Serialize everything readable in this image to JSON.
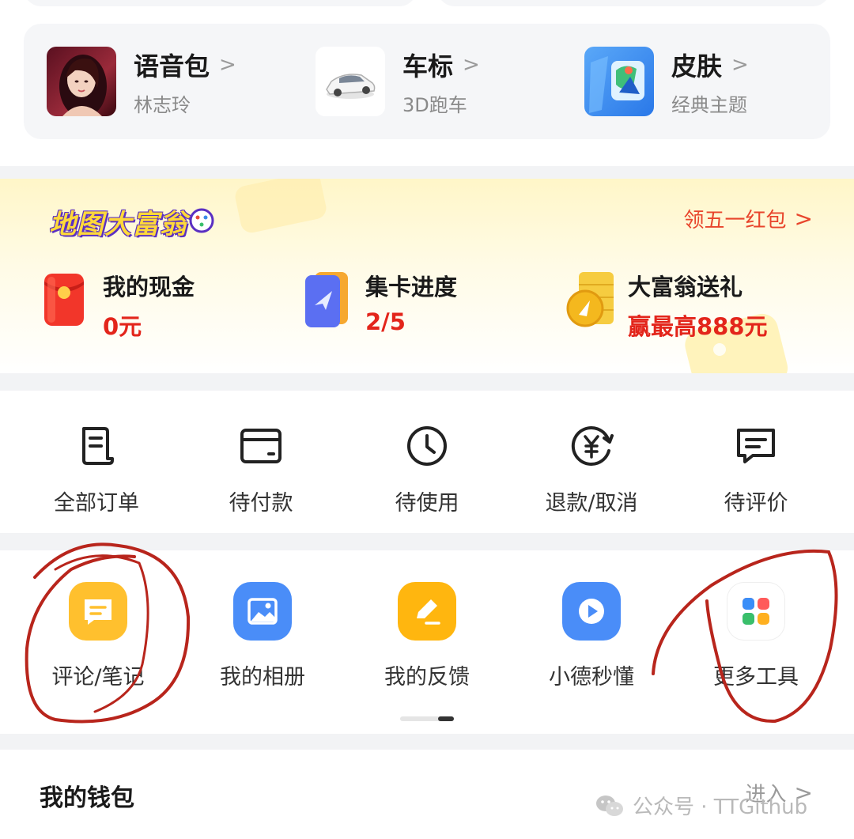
{
  "personalization": [
    {
      "title": "语音包",
      "subtitle": "林志玲",
      "icon": "voice-avatar"
    },
    {
      "title": "车标",
      "subtitle": "3D跑车",
      "icon": "car-icon"
    },
    {
      "title": "皮肤",
      "subtitle": "经典主题",
      "icon": "skin-map-icon"
    }
  ],
  "chevron": ">",
  "monopoly": {
    "logo_text": "地图大富翁",
    "link_label": "领五一红包",
    "items": [
      {
        "label": "我的现金",
        "value": "0元",
        "icon": "red-envelope-icon"
      },
      {
        "label": "集卡进度",
        "value": "2/5",
        "icon": "card-collection-icon"
      },
      {
        "label": "大富翁送礼",
        "value": "赢最高888元",
        "icon": "gold-coin-icon"
      }
    ]
  },
  "orders": [
    {
      "label": "全部订单",
      "icon": "order-list-icon"
    },
    {
      "label": "待付款",
      "icon": "wallet-card-icon"
    },
    {
      "label": "待使用",
      "icon": "clock-icon"
    },
    {
      "label": "退款/取消",
      "icon": "yuan-refund-icon"
    },
    {
      "label": "待评价",
      "icon": "comment-icon"
    }
  ],
  "tools": [
    {
      "label": "评论/笔记",
      "icon": "note-bubble-icon",
      "color": "#ffc02e"
    },
    {
      "label": "我的相册",
      "icon": "photo-album-icon",
      "color": "#4a8df8"
    },
    {
      "label": "我的反馈",
      "icon": "feedback-pen-icon",
      "color": "#ffb60f"
    },
    {
      "label": "小德秒懂",
      "icon": "play-video-icon",
      "color": "#4a8df8"
    },
    {
      "label": "更多工具",
      "icon": "more-grid-icon",
      "color": "#ffffff"
    }
  ],
  "wallet": {
    "title": "我的钱包",
    "enter_label": "进入"
  },
  "watermark": "公众号 · TTGithub",
  "colors": {
    "accent_red": "#e3251b",
    "link_red": "#e8452c",
    "annotation_red": "#b8251c",
    "tool_blue": "#4a8df8",
    "tool_yellow": "#ffc02e"
  }
}
